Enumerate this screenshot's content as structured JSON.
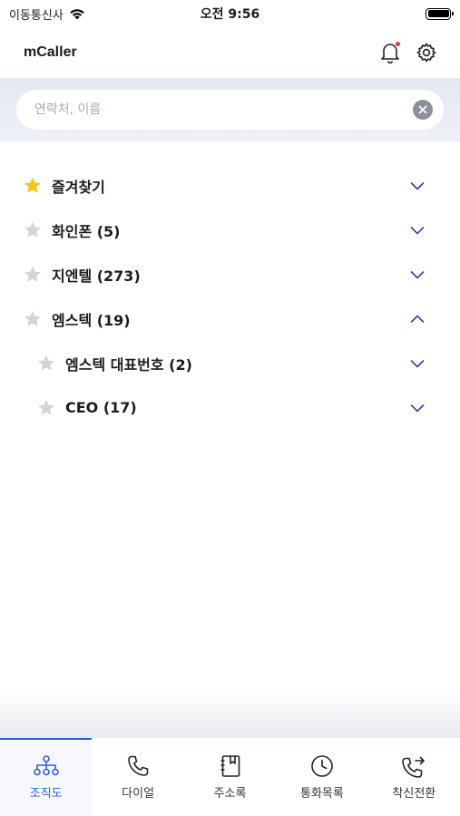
{
  "status_bar": {
    "carrier": "이동통신사",
    "time": "오전 9:56"
  },
  "header": {
    "title": "mCaller"
  },
  "search": {
    "placeholder": "연락처, 이름",
    "value": ""
  },
  "org_tree": [
    {
      "label": "즐겨찾기",
      "level": 0,
      "favorite": true,
      "expanded": false
    },
    {
      "label": "화인폰 (5)",
      "level": 0,
      "favorite": false,
      "expanded": false
    },
    {
      "label": "지엔텔 (273)",
      "level": 0,
      "favorite": false,
      "expanded": false
    },
    {
      "label": "엠스텍 (19)",
      "level": 0,
      "favorite": false,
      "expanded": true
    },
    {
      "label": "엠스텍 대표번호 (2)",
      "level": 1,
      "favorite": false,
      "expanded": false
    },
    {
      "label": "CEO (17)",
      "level": 1,
      "favorite": false,
      "expanded": false
    }
  ],
  "tabs": [
    {
      "label": "조직도",
      "icon": "org-chart-icon",
      "active": true
    },
    {
      "label": "다이얼",
      "icon": "phone-icon",
      "active": false
    },
    {
      "label": "주소록",
      "icon": "address-book-icon",
      "active": false
    },
    {
      "label": "통화목록",
      "icon": "clock-icon",
      "active": false
    },
    {
      "label": "착신전환",
      "icon": "call-forward-icon",
      "active": false
    }
  ],
  "colors": {
    "accent": "#2f5fd8",
    "favorite_star": "#f5c518",
    "inactive_star": "#d4d4d8",
    "chevron": "#3b3f8f"
  }
}
